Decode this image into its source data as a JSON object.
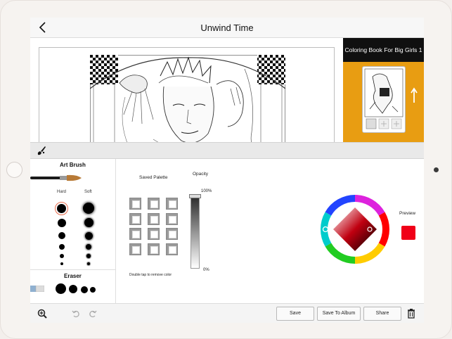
{
  "header": {
    "title": "Unwind Time"
  },
  "book": {
    "title": "Coloring Book For Big Girls 1"
  },
  "art_brush": {
    "title": "Art Brush",
    "hard_label": "Hard",
    "soft_label": "Soft"
  },
  "eraser": {
    "title": "Eraser"
  },
  "palette": {
    "saved_label": "Saved Palette",
    "hint": "Double tap to remove color",
    "swatch_count": 12
  },
  "opacity": {
    "label": "Opacity",
    "max_label": "100%",
    "min_label": "0%",
    "value": 1.0
  },
  "preview": {
    "label": "Preview",
    "color": "#f00018"
  },
  "toolbar": {
    "save": "Save",
    "save_to_album": "Save To Album",
    "share": "Share"
  },
  "icons": {
    "back": "chevron-left-icon",
    "brush_tool": "brush-icon",
    "zoom": "zoom-in-icon",
    "undo": "undo-icon",
    "redo": "redo-icon",
    "trash": "trash-icon",
    "upload": "arrow-up-icon"
  }
}
